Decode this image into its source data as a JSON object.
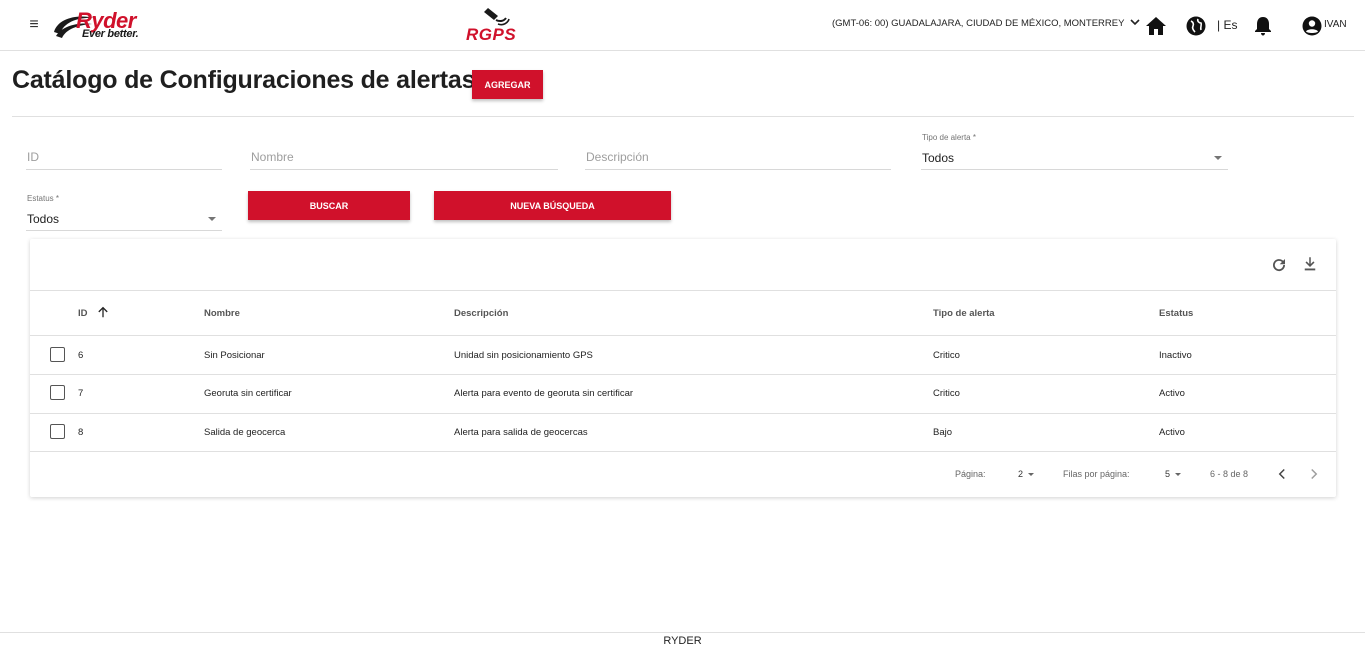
{
  "header": {
    "logo_text": "Ryder",
    "logo_tagline": "Ever better.",
    "product_logo": "RGPS",
    "timezone": "(GMT-06: 00) GUADALAJARA, CIUDAD DE MÉXICO, MONTERREY",
    "language": "| Es",
    "user": "IVAN",
    "icons": [
      "menu-icon",
      "home-icon",
      "globe-icon",
      "bell-icon",
      "account-icon"
    ]
  },
  "page": {
    "title": "Catálogo de Configuraciones de alertas",
    "add_button": "AGREGAR"
  },
  "filters": {
    "id_placeholder": "ID",
    "name_placeholder": "Nombre",
    "description_placeholder": "Descripción",
    "alert_type_label": "Tipo de alerta *",
    "alert_type_value": "Todos",
    "status_label": "Estatus *",
    "status_value": "Todos",
    "search_button": "BUSCAR",
    "new_search_button": "NUEVA BÚSQUEDA"
  },
  "table": {
    "columns": [
      "ID",
      "Nombre",
      "Descripción",
      "Tipo de alerta",
      "Estatus"
    ],
    "rows": [
      {
        "id": "6",
        "name": "Sin Posicionar",
        "description": "Unidad sin posicionamiento GPS",
        "type": "Critico",
        "status": "Inactivo"
      },
      {
        "id": "7",
        "name": "Georuta sin certificar",
        "description": "Alerta para evento de georuta sin certificar",
        "type": "Critico",
        "status": "Activo"
      },
      {
        "id": "8",
        "name": "Salida de geocerca",
        "description": "Alerta para salida de geocercas",
        "type": "Bajo",
        "status": "Activo"
      }
    ]
  },
  "pagination": {
    "page_label": "Página:",
    "page_value": "2",
    "rows_label": "Filas por página:",
    "rows_value": "5",
    "range": "6 - 8 de 8"
  },
  "footer": {
    "text": "RYDER"
  },
  "colors": {
    "brand_red": "#d0112b"
  }
}
